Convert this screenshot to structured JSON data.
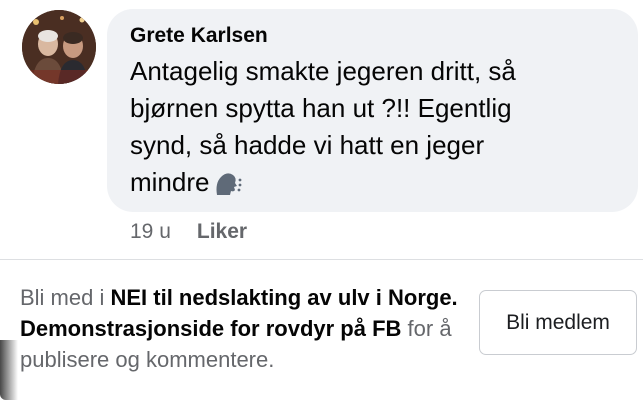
{
  "comment": {
    "author": "Grete Karlsen",
    "text": "Antagelig smakte jegeren dritt, så bjørnen spytta han ut ?!! Egentlig synd, så hadde vi hatt en jeger mindre",
    "emoji_icon": "speaking-head-emoji",
    "time": "19 u",
    "like_label": "Liker"
  },
  "join_prompt": {
    "prefix": "Bli med i ",
    "group_name": "NEI til nedslakting av ulv i Norge. Demonstrasjonside for rovdyr på FB",
    "suffix": " for å publisere og kommentere.",
    "button_label": "Bli medlem"
  },
  "colors": {
    "bubble_bg": "#f0f2f5",
    "text_primary": "#050505",
    "text_secondary": "#65676b",
    "button_border": "#c9ccd1"
  }
}
